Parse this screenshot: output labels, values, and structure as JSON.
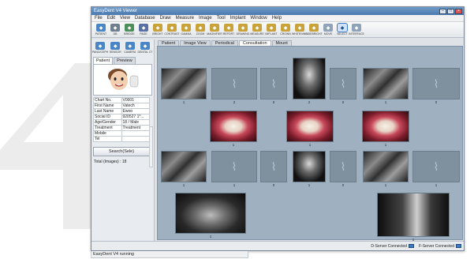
{
  "window": {
    "title": "EasyDent V4 Viewer",
    "min": "–",
    "max": "□",
    "close": "×"
  },
  "menu": [
    "File",
    "Edit",
    "View",
    "Database",
    "Draw",
    "Measure",
    "Image",
    "Tool",
    "Implant",
    "Window",
    "Help"
  ],
  "toolbar": [
    {
      "label": "PATIENT",
      "icon": "patient-icon",
      "color": "#4a86c5"
    },
    {
      "label": "DB",
      "icon": "database-icon",
      "color": "#6f7f90"
    },
    {
      "label": "BRIDGE",
      "icon": "bridge-icon",
      "color": "#4d8f5a"
    },
    {
      "label": "PAGE",
      "icon": "page-icon",
      "color": "#5a6fa3"
    },
    {
      "label": "BRIGHT",
      "icon": "bright-icon",
      "color": "#c9a23a"
    },
    {
      "label": "CONTRAST",
      "icon": "contrast-icon",
      "color": "#c9a23a"
    },
    {
      "label": "GAMMA",
      "icon": "gamma-icon",
      "color": "#c9a23a"
    },
    {
      "label": "ZOOM",
      "icon": "zoom-icon",
      "color": "#c9a23a"
    },
    {
      "label": "MAGNIFIER",
      "icon": "magnifier-icon",
      "color": "#c9a23a"
    },
    {
      "label": "REPORT",
      "icon": "report-icon",
      "color": "#c9a23a"
    },
    {
      "label": "DRAWING",
      "icon": "drawing-icon",
      "color": "#c9a23a"
    },
    {
      "label": "MEASURE",
      "icon": "measure-icon",
      "color": "#c9a23a"
    },
    {
      "label": "IMPLANT",
      "icon": "implant-icon",
      "color": "#c9a23a"
    },
    {
      "label": "CROWN",
      "icon": "crown-icon",
      "color": "#c9a23a"
    },
    {
      "label": "WHITENING",
      "icon": "whitening-icon",
      "color": "#c9a23a"
    },
    {
      "label": "SIDEBRIGHT",
      "icon": "sidebright-icon",
      "color": "#c9a23a"
    },
    {
      "label": "MOVE",
      "icon": "move-icon",
      "color": "#8fa3b8"
    },
    {
      "label": "SELECT",
      "icon": "select-icon",
      "color": "#3b79c4",
      "selected": true
    },
    {
      "label": "INTERFACE",
      "icon": "interface-icon",
      "color": "#8fa3b8"
    }
  ],
  "left_tools": [
    {
      "label": "PANO/CEPH",
      "icon": "pano-ceph-icon",
      "color": "#4a86c5"
    },
    {
      "label": "SENSOR",
      "icon": "sensor-icon",
      "color": "#4a86c5"
    },
    {
      "label": "CAMERA",
      "icon": "camera-icon",
      "color": "#4a86c5"
    },
    {
      "label": "DENTAL CT",
      "icon": "dental-ct-icon",
      "color": "#4a86c5"
    }
  ],
  "left_tabs": [
    "Patient",
    "Preview"
  ],
  "patient_info": [
    {
      "key": "Chart No.",
      "val": "V0001"
    },
    {
      "key": "First Name",
      "val": "Vatech"
    },
    {
      "key": "Last Name",
      "val": "Ewoo"
    },
    {
      "key": "Social ID",
      "val": "920527 1*..."
    },
    {
      "key": "Age/Gender",
      "val": "18 / Male"
    },
    {
      "key": "Treatment",
      "val": "Treatment"
    },
    {
      "key": "Mobile",
      "val": ""
    },
    {
      "key": "Tel",
      "val": ""
    }
  ],
  "search_label": "Search(Sele)",
  "total_images": "Total (Images) : 18",
  "main_tabs": [
    "Patient",
    "Image View",
    "Periodical",
    "Consultation",
    "Mount"
  ],
  "thumb_nums": {
    "r1": [
      "1",
      "2",
      "0",
      "2",
      "0",
      "1",
      "0"
    ],
    "r2": [
      "1",
      "1",
      "1"
    ],
    "r3": [
      "1",
      "1",
      "0",
      "1",
      "0",
      "1",
      "1"
    ],
    "r4": [
      "1",
      "1"
    ]
  },
  "status": {
    "d_server": "D-Server Connected",
    "f_server": "F-Server Connected",
    "app": "EasyDent V4 running"
  }
}
